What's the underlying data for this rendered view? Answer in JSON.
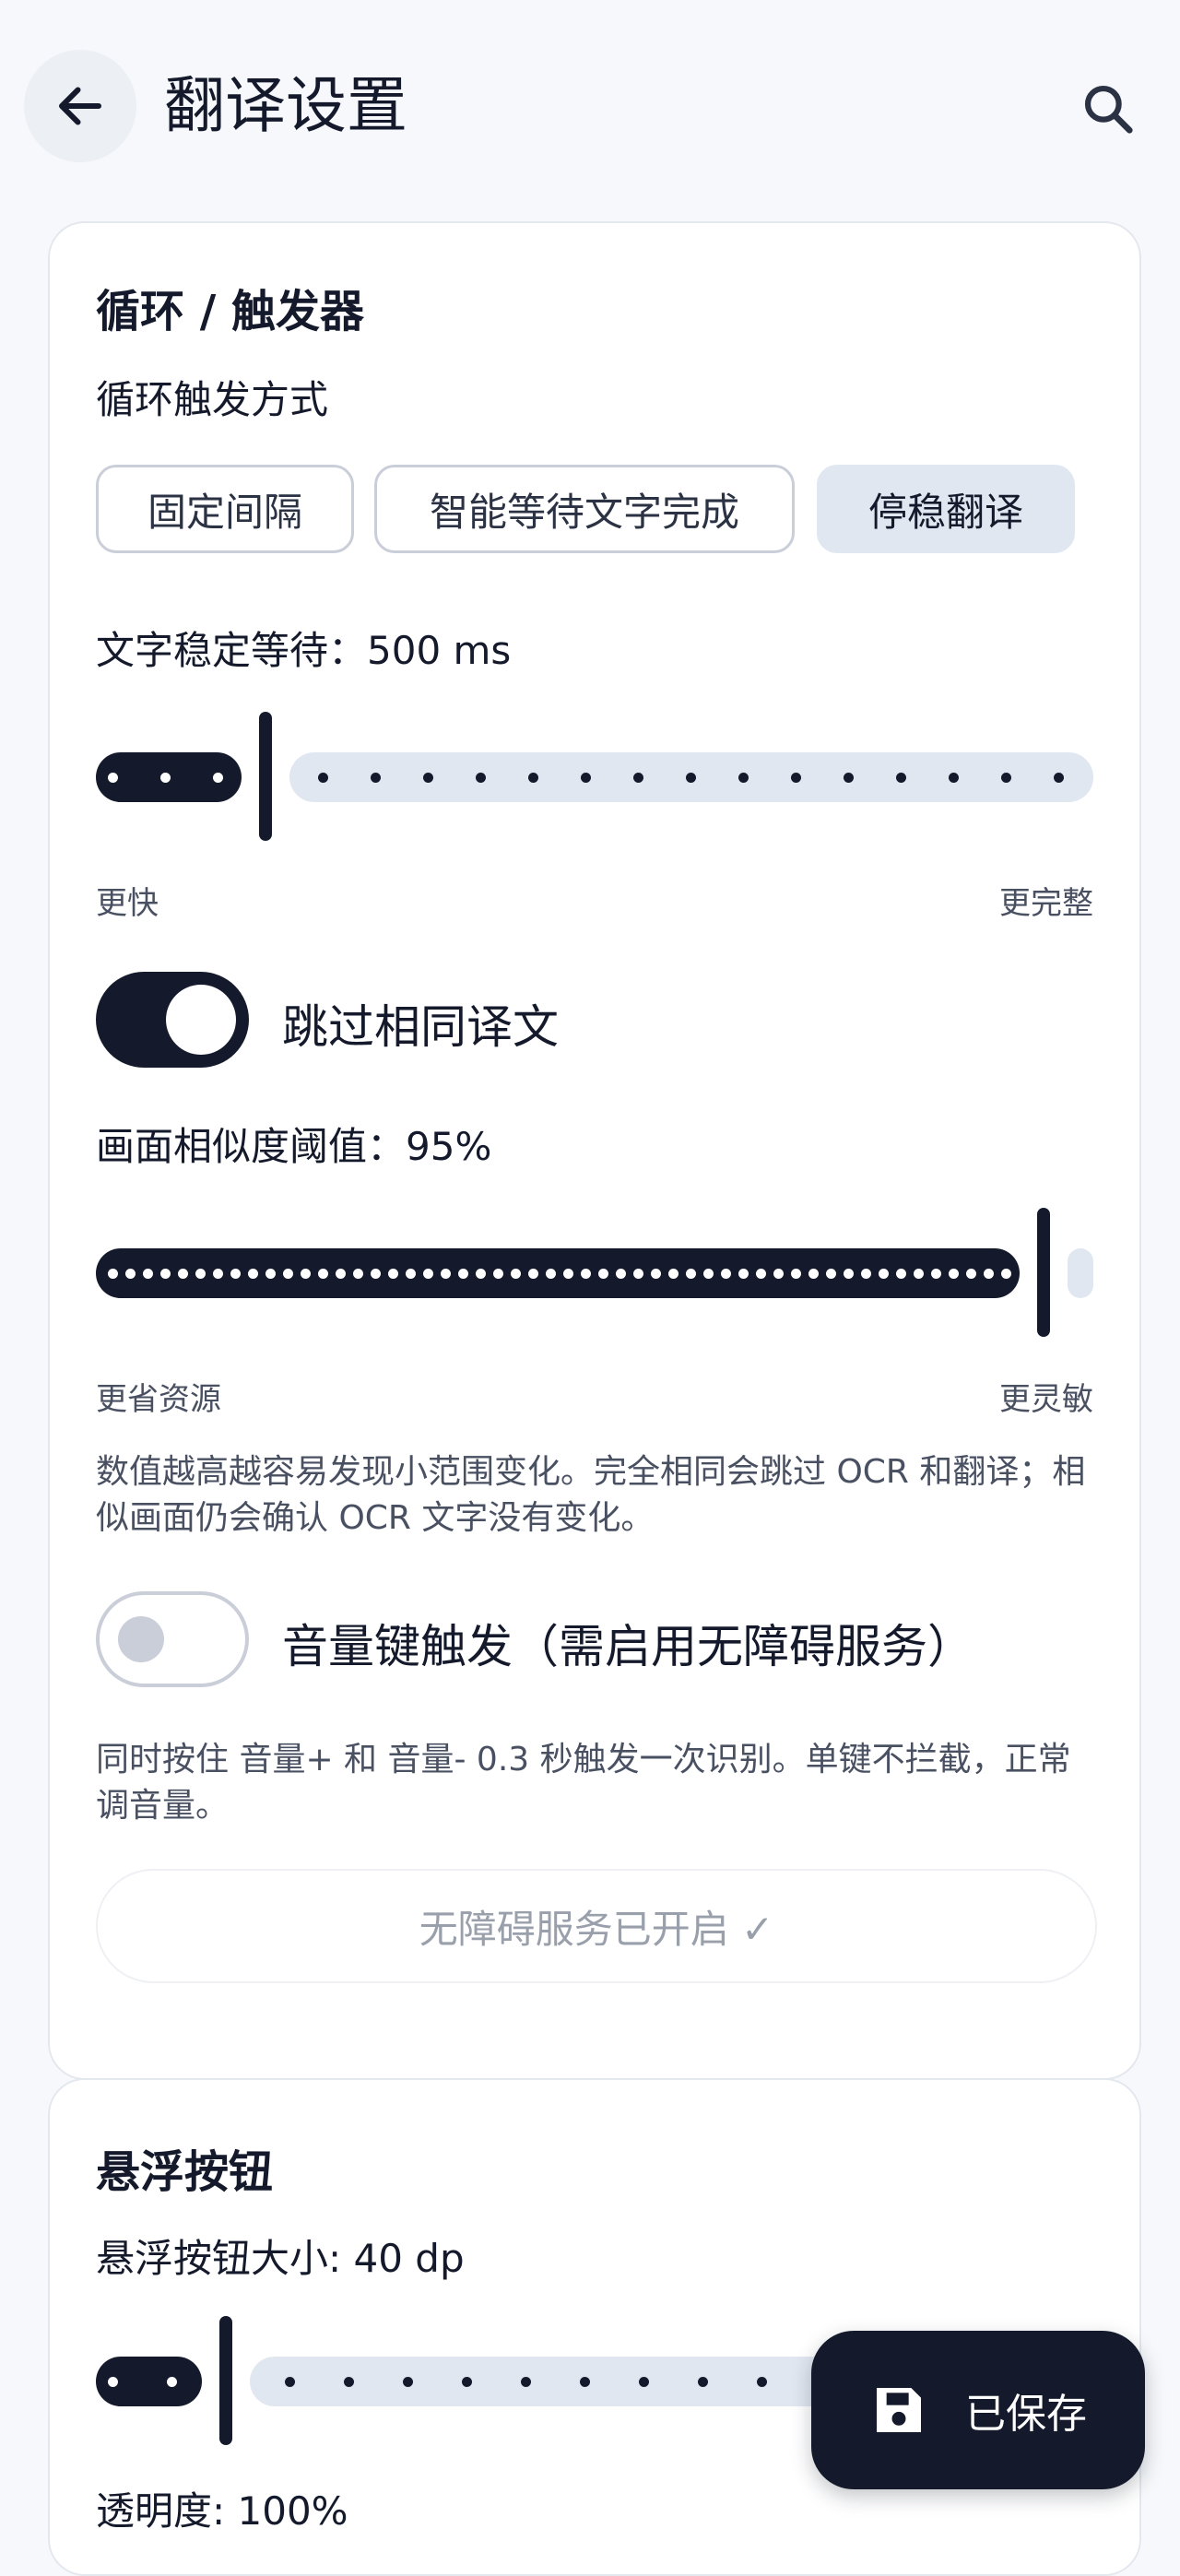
{
  "header": {
    "title": "翻译设置",
    "back_icon": "arrow-left-icon",
    "search_icon": "search-icon"
  },
  "loop_card": {
    "title": "循环 / 触发器",
    "trigger_mode_label": "循环触发方式",
    "modes": [
      "固定间隔",
      "智能等待文字完成",
      "停稳翻译"
    ],
    "selected_mode": "停稳翻译",
    "stable_wait_label": "文字稳定等待：500 ms",
    "stable_wait_level": 0.17,
    "stable_wait_min_label": "更快",
    "stable_wait_max_label": "更完整",
    "skip_same_label": "跳过相同译文",
    "skip_same_on": true,
    "similarity_label": "画面相似度阈值：95%",
    "similarity_level": 0.95,
    "similarity_min_label": "更省资源",
    "similarity_max_label": "更灵敏",
    "similarity_desc": "数值越高越容易发现小范围变化。完全相同会跳过 OCR 和翻译；相似画面仍会确认 OCR 文字没有变化。",
    "volume_key_label": "音量键触发（需启用无障碍服务）",
    "volume_key_on": false,
    "volume_key_desc": "同时按住 音量+ 和 音量- 0.3 秒触发一次识别。单键不拦截，正常调音量。",
    "accessibility_status": "无障碍服务已开启 ✓"
  },
  "float_card": {
    "title": "悬浮按钮",
    "size_label": "悬浮按钮大小: 40 dp",
    "size_level": 0.13,
    "opacity_label": "透明度: 100%"
  },
  "fab": {
    "label": "已保存",
    "icon": "save-icon"
  },
  "colors": {
    "primary": "#141a2b",
    "track_inactive": "#e1e7f0",
    "background": "#f6f8fb"
  }
}
